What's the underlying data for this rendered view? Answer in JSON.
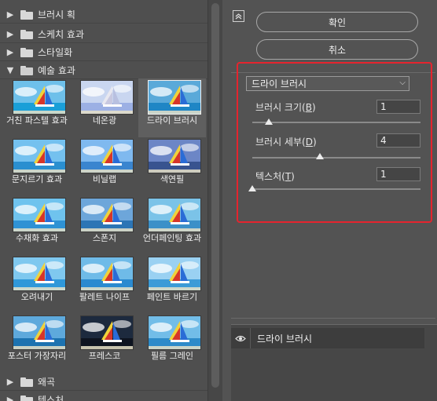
{
  "categories_top": [
    {
      "label": "브러시 획",
      "expanded": false
    },
    {
      "label": "스케치 효과",
      "expanded": false
    },
    {
      "label": "스타일화",
      "expanded": false
    },
    {
      "label": "예술 효과",
      "expanded": true
    }
  ],
  "filters": [
    {
      "label": "거친 파스텔 효과",
      "selected": false
    },
    {
      "label": "네온광",
      "selected": false
    },
    {
      "label": "드라이 브러시",
      "selected": true
    },
    {
      "label": "문지르기 효과",
      "selected": false
    },
    {
      "label": "비닐랩",
      "selected": false
    },
    {
      "label": "색연필",
      "selected": false
    },
    {
      "label": "수채화 효과",
      "selected": false
    },
    {
      "label": "스폰지",
      "selected": false
    },
    {
      "label": "언더페인팅 효과",
      "selected": false
    },
    {
      "label": "오려내기",
      "selected": false
    },
    {
      "label": "팔레트 나이프",
      "selected": false
    },
    {
      "label": "페인트 바르기",
      "selected": false
    },
    {
      "label": "포스터 가장자리",
      "selected": false
    },
    {
      "label": "프레스코",
      "selected": false
    },
    {
      "label": "필름 그레인",
      "selected": false
    }
  ],
  "categories_bottom": [
    {
      "label": "왜곡",
      "expanded": false
    },
    {
      "label": "텍스처",
      "expanded": false
    }
  ],
  "buttons": {
    "ok": "확인",
    "cancel": "취소"
  },
  "settings": {
    "filter_select": "드라이 브러시",
    "params": [
      {
        "label": "브러시 크기(",
        "key": "B",
        "suffix": ")",
        "value": "1",
        "level": 0.1
      },
      {
        "label": "브러시 세부(",
        "key": "D",
        "suffix": ")",
        "value": "4",
        "level": 0.4
      },
      {
        "label": "텍스처(",
        "key": "T",
        "suffix": ")",
        "value": "1",
        "level": 0.0
      }
    ]
  },
  "layers": [
    {
      "name": "드라이 브러시",
      "visible": true
    }
  ],
  "colors": {
    "highlight_box": "#e5242e"
  }
}
